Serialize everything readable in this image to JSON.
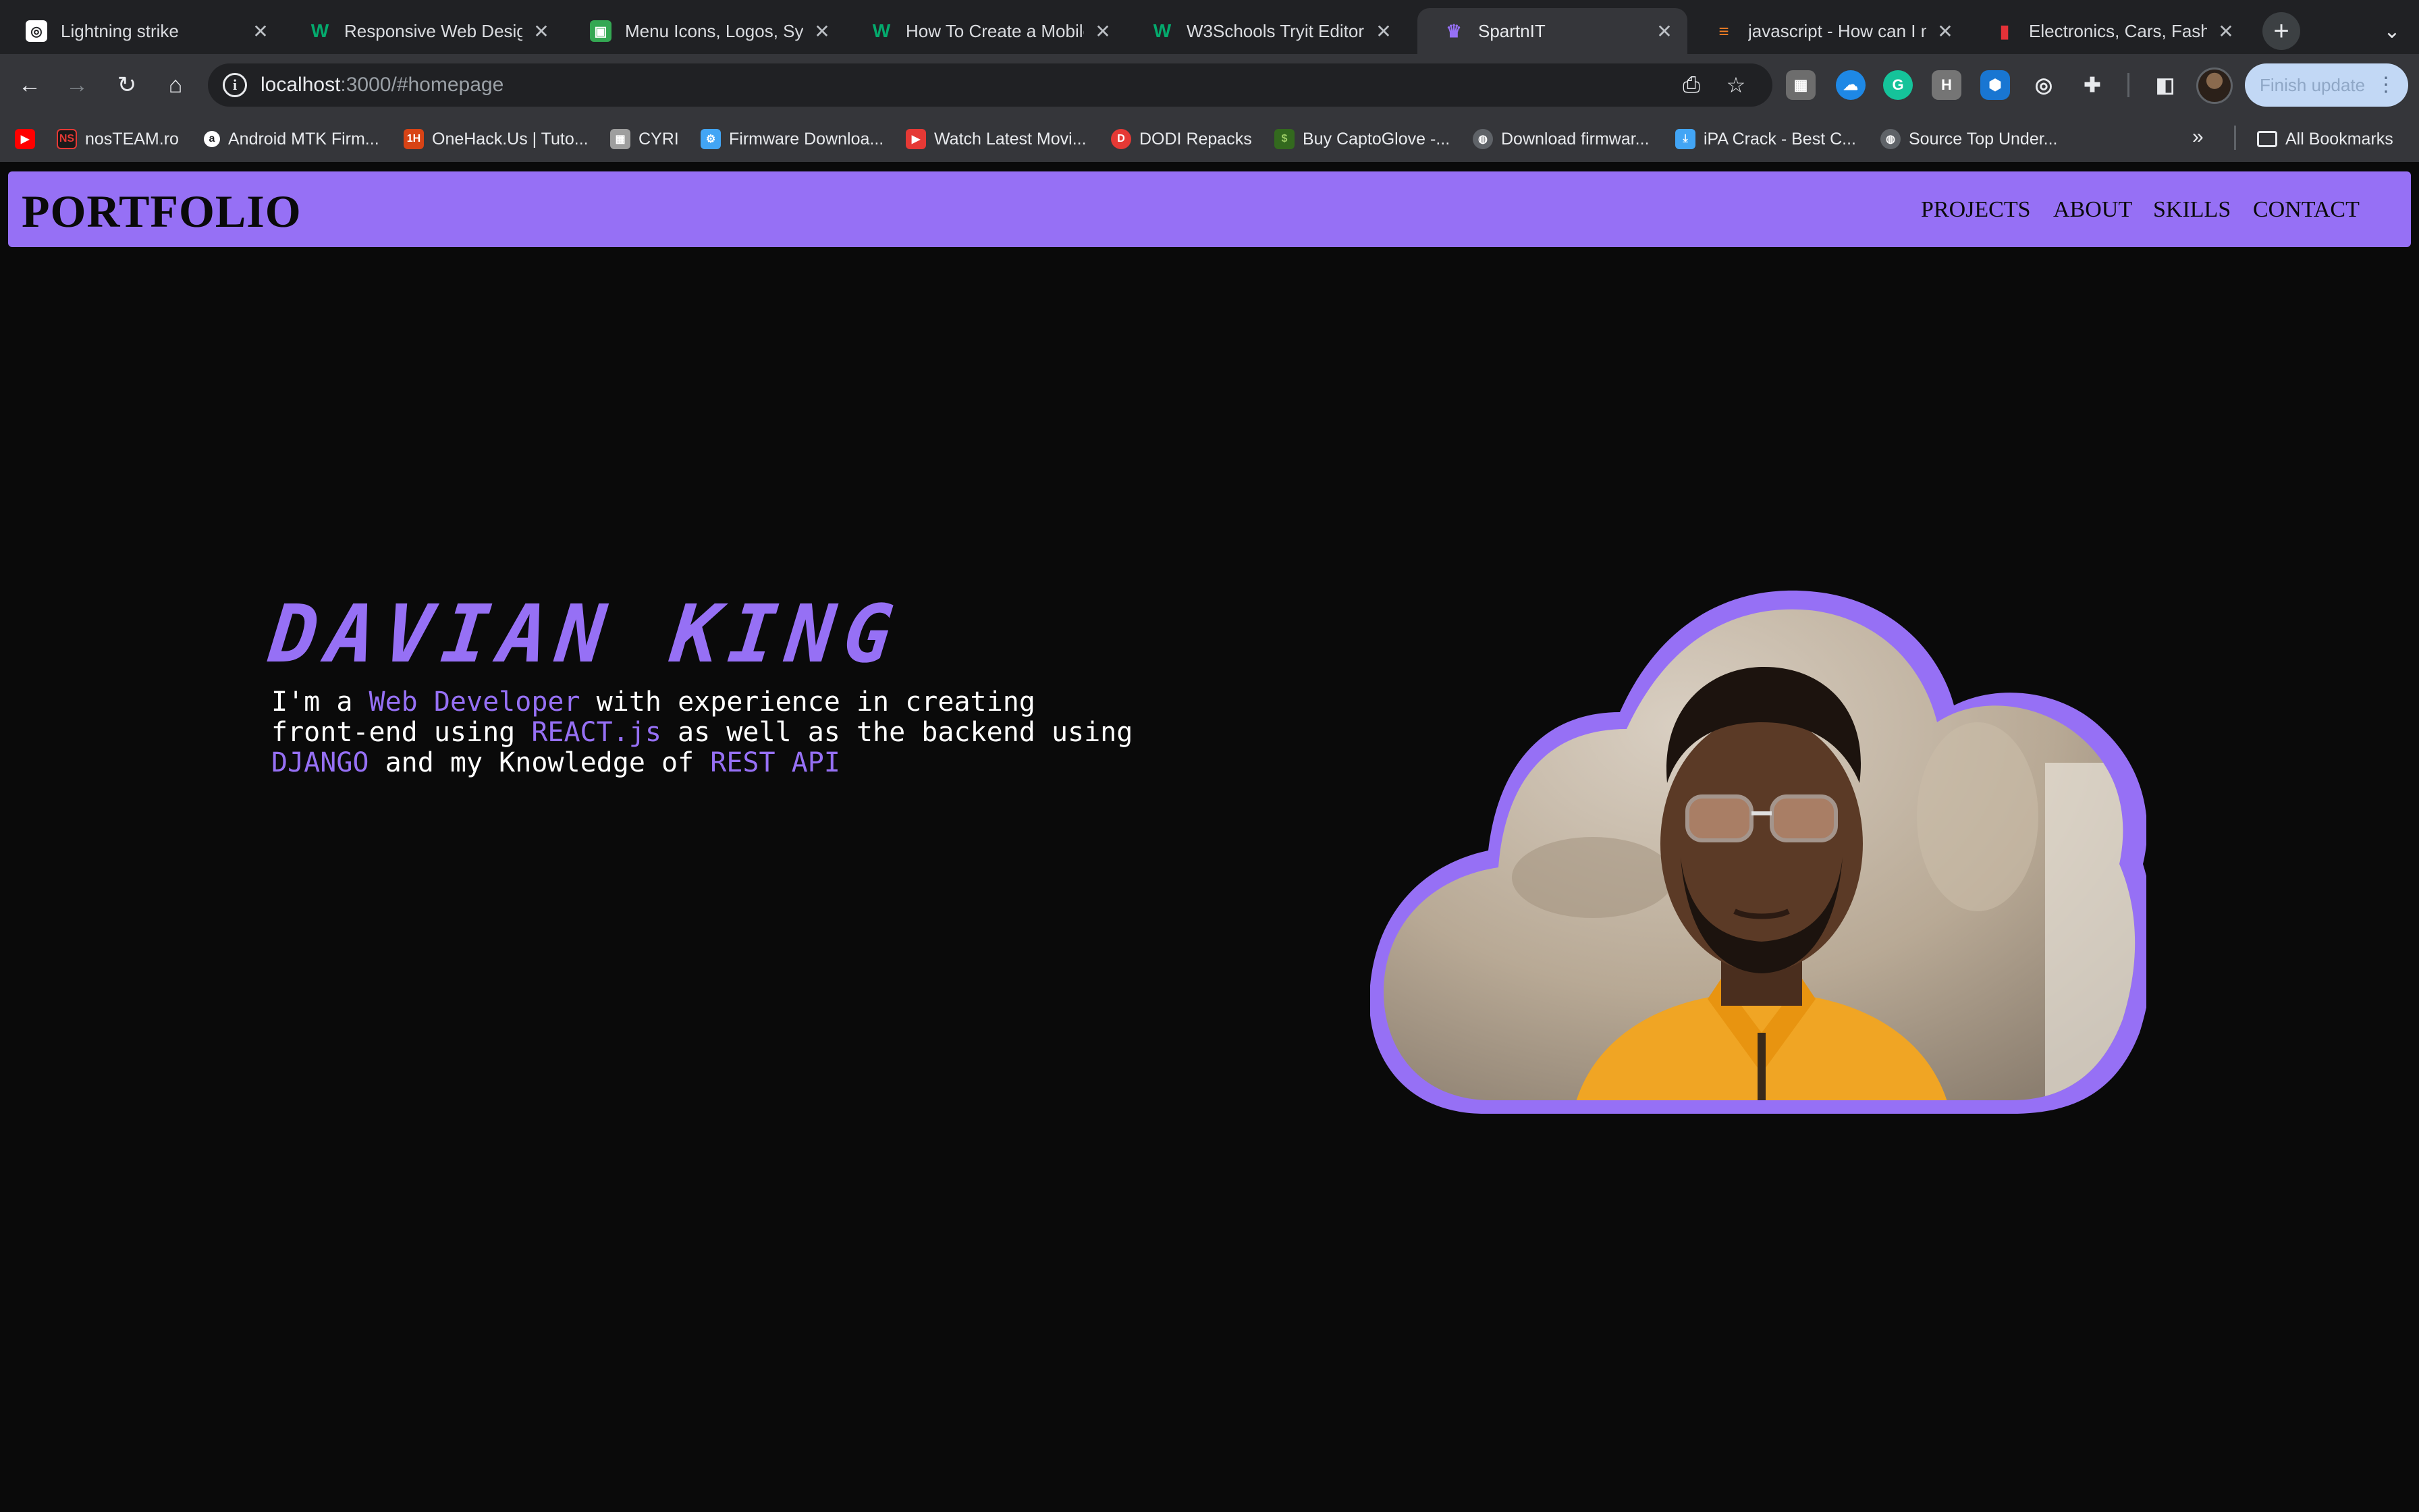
{
  "browser": {
    "tabs": [
      {
        "title": "Lightning strike",
        "active": false,
        "favicon": "white-square-logo-icon",
        "color": "#ffffff"
      },
      {
        "title": "Responsive Web Design",
        "active": false,
        "favicon": "w3schools-icon",
        "color": "#04aa6d"
      },
      {
        "title": "Menu Icons, Logos, Sym",
        "active": false,
        "favicon": "green-square-icon",
        "color": "#34a853"
      },
      {
        "title": "How To Create a Mobile",
        "active": false,
        "favicon": "w3schools-icon",
        "color": "#04aa6d"
      },
      {
        "title": "W3Schools Tryit Editor",
        "active": false,
        "favicon": "w3schools-icon",
        "color": "#04aa6d"
      },
      {
        "title": "SpartnIT",
        "active": true,
        "favicon": "spartan-helmet-icon",
        "color": "#9670f5"
      },
      {
        "title": "javascript - How can I m",
        "active": false,
        "favicon": "stackoverflow-icon",
        "color": "#f48024"
      },
      {
        "title": "Electronics, Cars, Fashic",
        "active": false,
        "favicon": "ebay-icon",
        "color": "#e53238"
      }
    ],
    "address": {
      "host": "localhost",
      "path": ":3000/#homepage"
    },
    "finish_update_label": "Finish update",
    "bookmarks": [
      {
        "label": "",
        "icon": "youtube-icon",
        "color": "#ff0000"
      },
      {
        "label": "nosTEAM.ro",
        "icon": "ns-logo-icon",
        "color": "#c62828"
      },
      {
        "label": "Android MTK Firm...",
        "icon": "circle-a-icon",
        "color": "#ffffff"
      },
      {
        "label": "OneHack.Us | Tuto...",
        "icon": "1h-logo-icon",
        "color": "#d84315"
      },
      {
        "label": "CYRI",
        "icon": "cyri-logo-icon",
        "color": "#9e9e9e"
      },
      {
        "label": "Firmware Downloa...",
        "icon": "firmware-icon",
        "color": "#42a5f5"
      },
      {
        "label": "Watch Latest Movi...",
        "icon": "play-icon",
        "color": "#e53935"
      },
      {
        "label": "DODI Repacks",
        "icon": "dodi-icon",
        "color": "#e53935"
      },
      {
        "label": "Buy CaptoGlove -...",
        "icon": "captoglove-icon",
        "color": "#9ccc65"
      },
      {
        "label": "Download firmwar...",
        "icon": "globe-icon",
        "color": "#9aa0a6"
      },
      {
        "label": "iPA Crack - Best C...",
        "icon": "download-icon",
        "color": "#42a5f5"
      },
      {
        "label": "Source Top Under...",
        "icon": "globe-icon",
        "color": "#9aa0a6"
      }
    ],
    "all_bookmarks_label": "All Bookmarks"
  },
  "site": {
    "brand": "PORTFOLIO",
    "nav": [
      "PROJECTS",
      "ABOUT",
      "SKILLS",
      "CONTACT"
    ],
    "hero": {
      "name": "DAVIAN KING",
      "intro": [
        {
          "text": "I'm a ",
          "hl": false
        },
        {
          "text": "Web Developer",
          "hl": true
        },
        {
          "text": " with experience in creating front-end using ",
          "hl": false
        },
        {
          "text": "REACT.js",
          "hl": true
        },
        {
          "text": " as well as the backend using ",
          "hl": false
        },
        {
          "text": "DJANGO",
          "hl": true
        },
        {
          "text": " and my Knowledge of ",
          "hl": false
        },
        {
          "text": "REST API",
          "hl": true
        }
      ]
    },
    "colors": {
      "accent": "#9670f5",
      "background": "#0a0a0a",
      "text": "#ffffff"
    }
  }
}
